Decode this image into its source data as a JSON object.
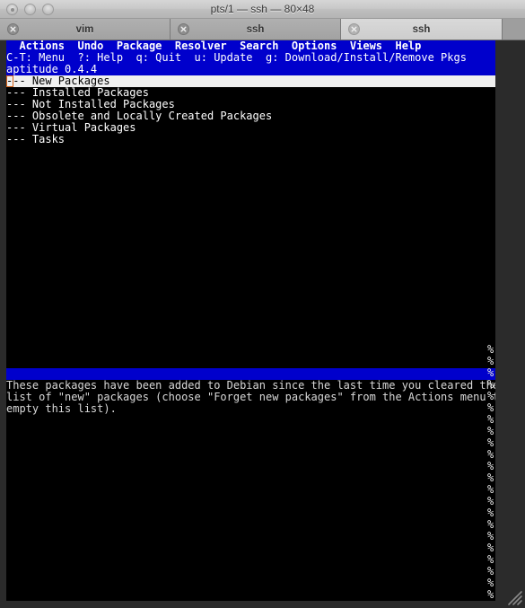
{
  "window": {
    "title": "pts/1 — ssh — 80×48",
    "controls": [
      {
        "name": "close-button",
        "state": "dotted"
      },
      {
        "name": "minimize-button",
        "state": "plain"
      },
      {
        "name": "zoom-button",
        "state": "plain"
      }
    ]
  },
  "tabs": [
    {
      "label": "vim",
      "active": false
    },
    {
      "label": "ssh",
      "active": false
    },
    {
      "label": "ssh",
      "active": true
    }
  ],
  "terminal": {
    "menu_items": [
      "Actions",
      "Undo",
      "Package",
      "Resolver",
      "Search",
      "Options",
      "Views",
      "Help"
    ],
    "menu_line": "  Actions  Undo  Package  Resolver  Search  Options  Views  Help",
    "help_line": "C-T: Menu  ?: Help  q: Quit  u: Update  g: Download/Install/Remove Pkgs",
    "version_line": "aptitude 0.4.4",
    "tree_rows": [
      {
        "text": "--- New Packages",
        "selected": true
      },
      {
        "text": "--- Installed Packages",
        "selected": false
      },
      {
        "text": "--- Not Installed Packages",
        "selected": false
      },
      {
        "text": "--- Obsolete and Locally Created Packages",
        "selected": false
      },
      {
        "text": "--- Virtual Packages",
        "selected": false
      },
      {
        "text": "--- Tasks",
        "selected": false
      }
    ],
    "description_lines": [
      "These packages have been added to Debian since the last time you cleared the",
      "list of \"new\" packages (choose \"Forget new packages\" from the Actions menu to",
      "empty this list)."
    ],
    "scroll_glyph": "%",
    "colors": {
      "background": "#000000",
      "foreground": "#d8d8d8",
      "accent_blue": "#0000cc",
      "selection_bg": "#f0f0f0",
      "cursor_outline": "#d4621a"
    }
  }
}
